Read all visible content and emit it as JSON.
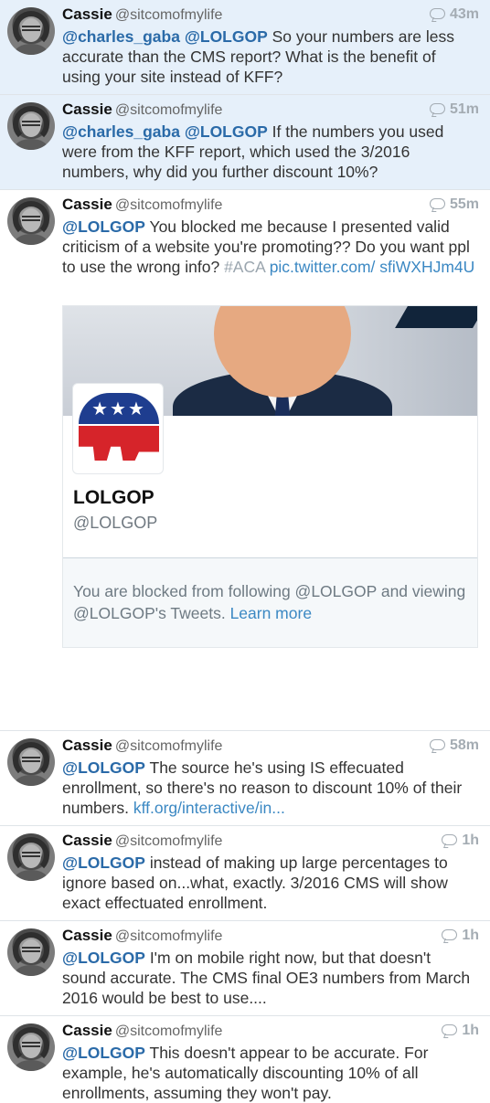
{
  "tweets": [
    {
      "name": "Cassie",
      "handle": "@sitcomofmylife",
      "time": "43m",
      "parts": [
        {
          "t": "@charles_gaba",
          "k": "mention"
        },
        {
          "t": " ",
          "k": "plain"
        },
        {
          "t": "@LOLGOP",
          "k": "mention"
        },
        {
          "t": " So your numbers are less accurate than the CMS report? What is the benefit of using your site instead of KFF?",
          "k": "plain"
        }
      ]
    },
    {
      "name": "Cassie",
      "handle": "@sitcomofmylife",
      "time": "51m",
      "parts": [
        {
          "t": "@charles_gaba",
          "k": "mention"
        },
        {
          "t": " ",
          "k": "plain"
        },
        {
          "t": "@LOLGOP",
          "k": "mention"
        },
        {
          "t": " If the numbers you used were from the KFF report, which used the 3/2016 numbers, why did you further discount 10%?",
          "k": "plain"
        }
      ]
    },
    {
      "name": "Cassie",
      "handle": "@sitcomofmylife",
      "time": "55m",
      "parts": [
        {
          "t": "@LOLGOP",
          "k": "mention"
        },
        {
          "t": " You blocked me because I presented valid criticism of a website you're promoting?? Do you want ppl to use the wrong info? ",
          "k": "plain"
        },
        {
          "t": "#ACA",
          "k": "hash"
        },
        {
          "t": " ",
          "k": "plain"
        },
        {
          "t": "pic.twitter.com/ sfiWXHJm4U",
          "k": "link"
        }
      ]
    },
    {
      "name": "Cassie",
      "handle": "@sitcomofmylife",
      "time": "58m",
      "parts": [
        {
          "t": "@LOLGOP",
          "k": "mention"
        },
        {
          "t": " The source he's using IS effecuated enrollment, so there's no reason to discount 10% of their numbers. ",
          "k": "plain"
        },
        {
          "t": "kff.org/interactive/in...",
          "k": "link"
        }
      ]
    },
    {
      "name": "Cassie",
      "handle": "@sitcomofmylife",
      "time": "1h",
      "parts": [
        {
          "t": "@LOLGOP",
          "k": "mention"
        },
        {
          "t": " instead of making up large percentages to ignore based on...what, exactly. 3/2016 CMS will show exact effectuated enrollment.",
          "k": "plain"
        }
      ]
    },
    {
      "name": "Cassie",
      "handle": "@sitcomofmylife",
      "time": "1h",
      "parts": [
        {
          "t": "@LOLGOP",
          "k": "mention"
        },
        {
          "t": " I'm on mobile right now, but that doesn't sound accurate. The CMS final OE3 numbers from March 2016 would be best to use....",
          "k": "plain"
        }
      ]
    },
    {
      "name": "Cassie",
      "handle": "@sitcomofmylife",
      "time": "1h",
      "parts": [
        {
          "t": "@LOLGOP",
          "k": "mention"
        },
        {
          "t": " This doesn't appear to be accurate. For example, he's automatically discounting 10% of all enrollments, assuming they won't pay.",
          "k": "plain"
        }
      ]
    }
  ],
  "card": {
    "logo_stars": "★★★",
    "profile_name": "LOLGOP",
    "profile_handle": "@LOLGOP",
    "blocked_text": "You are blocked from following @LOLGOP and viewing @LOLGOP's Tweets.",
    "learn_more": "Learn more"
  },
  "colors": {
    "highlight_bg": "#e6f0fa",
    "mention": "#2a6aa8",
    "link": "#3b88c3"
  }
}
